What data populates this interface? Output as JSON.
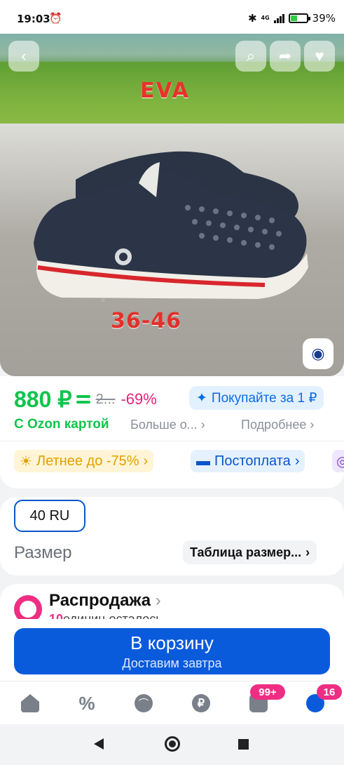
{
  "status_bar": {
    "time": "19:03",
    "network": "4G",
    "battery": "39%"
  },
  "hero": {
    "overlay_text_top": "EVA",
    "overlay_text_bottom": "36-46"
  },
  "price": {
    "current": "880 ₽",
    "old": "2...",
    "discount": "-69%",
    "buy_for": "Покупайте за 1 ₽",
    "ozon_card": "С Ozon картой",
    "more": "Больше о...",
    "details": "Подробнее"
  },
  "promos": [
    {
      "label": "Летнее до -75%"
    },
    {
      "label": "Постоплата"
    }
  ],
  "size": {
    "selected": "40 RU",
    "label": "Размер",
    "table_link": "Таблица размер..."
  },
  "sale": {
    "title": "Распродажа",
    "count": "10",
    "sub": "единиц осталось"
  },
  "cart": {
    "label": "В корзину",
    "sub": "Доставим завтра"
  },
  "tabbar": {
    "cart_badge": "99+",
    "profile_badge": "16"
  },
  "colors": {
    "accent": "#0a5bdc",
    "green": "#10c44c",
    "pink": "#ee2e83"
  }
}
